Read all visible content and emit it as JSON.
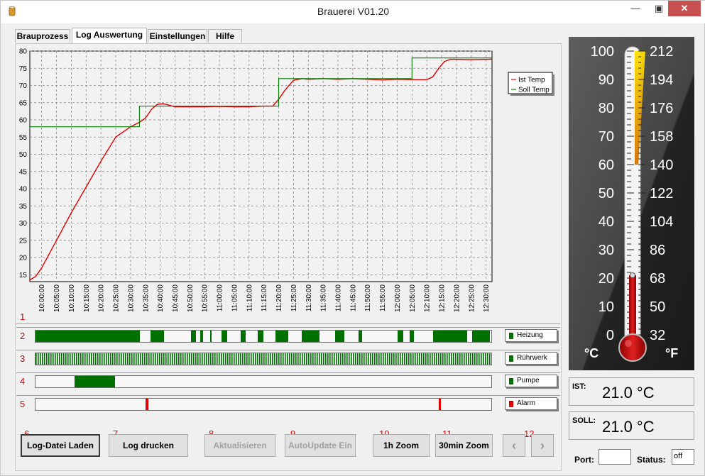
{
  "window": {
    "title": "Brauerei V01.20"
  },
  "tabs": [
    {
      "label": "Brauprozess"
    },
    {
      "label": "Log Auswertung"
    },
    {
      "label": "Einstellungen"
    },
    {
      "label": "Hilfe"
    }
  ],
  "chart_data": {
    "type": "line",
    "title": "",
    "xlabel": "",
    "ylabel": "",
    "ylim": [
      13,
      80
    ],
    "yticks": [
      15,
      20,
      25,
      30,
      35,
      40,
      45,
      50,
      55,
      60,
      65,
      70,
      75,
      80
    ],
    "x_ticks": [
      "10:00:00",
      "10:05:00",
      "10:10:00",
      "10:15:00",
      "10:20:00",
      "10:25:00",
      "10:30:00",
      "10:35:00",
      "10:40:00",
      "10:45:00",
      "10:50:00",
      "10:55:00",
      "11:00:00",
      "11:05:00",
      "11:10:00",
      "11:15:00",
      "11:20:00",
      "11:25:00",
      "11:30:00",
      "11:35:00",
      "11:40:00",
      "11:45:00",
      "11:50:00",
      "11:55:00",
      "12:00:00",
      "12:05:00",
      "12:10:00",
      "12:15:00",
      "12:20:00",
      "12:25:00",
      "12:30:00"
    ],
    "xlim_minutes": [
      -4,
      152
    ],
    "grid": true,
    "legend_position": "right",
    "series": [
      {
        "name": "Ist Temp",
        "color": "#e00000",
        "x_minutes": [
          -4,
          -2,
          0,
          5,
          10,
          15,
          20,
          25,
          30,
          33,
          35,
          37,
          39,
          41,
          43,
          45,
          50,
          55,
          60,
          65,
          70,
          75,
          78,
          80,
          82,
          85,
          88,
          90,
          95,
          100,
          105,
          110,
          115,
          120,
          125,
          130,
          132,
          134,
          136,
          138,
          140,
          145,
          150,
          152
        ],
        "values": [
          13.5,
          14.5,
          17,
          25,
          33,
          40.5,
          48,
          55,
          58,
          59.3,
          60.5,
          63,
          64.5,
          64.7,
          64.3,
          63.8,
          63.8,
          63.8,
          63.9,
          63.8,
          63.8,
          64,
          64,
          66,
          68.5,
          71.5,
          72,
          71.8,
          72,
          71.8,
          72,
          71.8,
          71.6,
          71.8,
          71.7,
          71.7,
          72.5,
          75,
          77,
          77.6,
          77.6,
          77.5,
          77.6,
          77.6
        ]
      },
      {
        "name": "Soll Temp",
        "color": "#008000",
        "x_minutes": [
          -4,
          33,
          33,
          80,
          80,
          125,
          125,
          152
        ],
        "values": [
          58,
          58,
          64,
          64,
          72,
          72,
          78,
          78
        ]
      }
    ]
  },
  "strips": [
    {
      "number": "2",
      "name": "Heizung",
      "color": "#007000",
      "on": [
        [
          0,
          147
        ],
        [
          162,
          181
        ],
        [
          219,
          226
        ],
        [
          232,
          236
        ],
        [
          246,
          248
        ],
        [
          262,
          270
        ],
        [
          289,
          296
        ],
        [
          313,
          321
        ],
        [
          338,
          356
        ],
        [
          375,
          400
        ],
        [
          422,
          435
        ],
        [
          455,
          460
        ],
        [
          510,
          518
        ],
        [
          527,
          533
        ],
        [
          560,
          608
        ],
        [
          615,
          640
        ]
      ]
    },
    {
      "number": "3",
      "name": "Rührwerk",
      "color": "#007000",
      "pattern": "dense"
    },
    {
      "number": "4",
      "name": "Pumpe",
      "color": "#007000",
      "on": [
        [
          55,
          112
        ]
      ]
    },
    {
      "number": "5",
      "name": "Alarm",
      "color": "#e00000",
      "on": [
        [
          155,
          159
        ],
        [
          568,
          571
        ]
      ]
    }
  ],
  "chart_number": "1",
  "buttons": [
    {
      "number": "6",
      "label": "Log-Datei Laden"
    },
    {
      "number": "7",
      "label": "Log drucken"
    },
    {
      "number": "8",
      "label": "Aktualisieren"
    },
    {
      "number": "9",
      "label": "AutoUpdate Ein"
    },
    {
      "number": "10",
      "label": "1h Zoom"
    },
    {
      "number": "11",
      "label": "30min Zoom"
    },
    {
      "number": "12",
      "prev": "‹",
      "next": "›"
    }
  ],
  "thermometer": {
    "celsius_ticks": [
      "100",
      "90",
      "80",
      "70",
      "60",
      "50",
      "40",
      "30",
      "20",
      "10",
      "0"
    ],
    "fahrenheit_ticks": [
      "212",
      "194",
      "176",
      "158",
      "140",
      "122",
      "104",
      "86",
      "68",
      "50",
      "32"
    ],
    "celsius_unit": "°C",
    "fahrenheit_unit": "°F",
    "current_celsius": 21.0,
    "setpoint_fraction": 1.0
  },
  "ist": {
    "label": "IST:",
    "value": "21.0 °C"
  },
  "soll": {
    "label": "SOLL:",
    "value": "21.0 °C"
  },
  "port": {
    "label": "Port:",
    "value": ""
  },
  "status": {
    "label": "Status:",
    "value": "off"
  }
}
